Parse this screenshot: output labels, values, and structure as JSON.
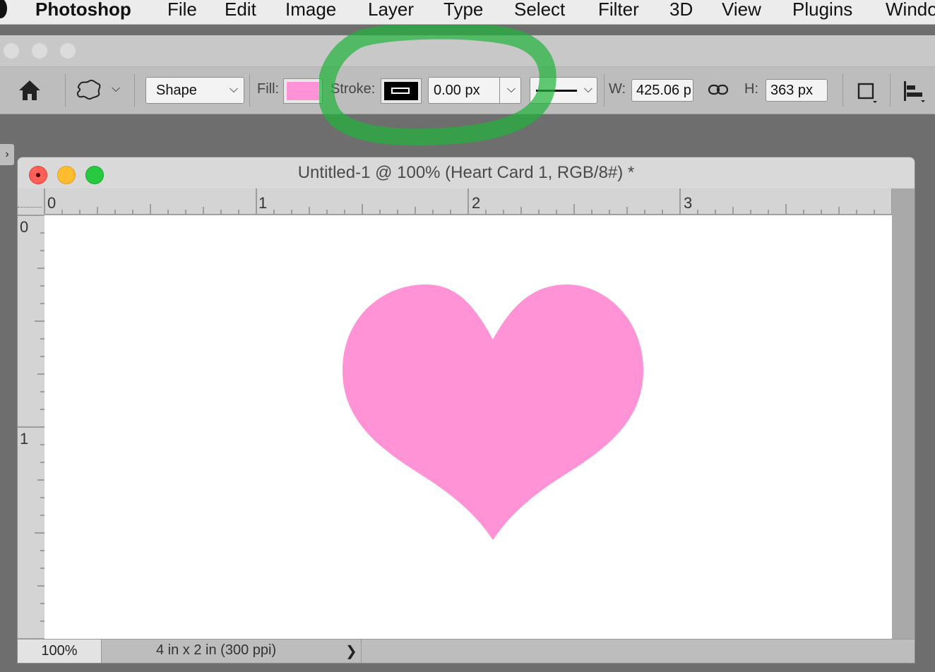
{
  "menubar": {
    "app_name": "Photoshop",
    "items": [
      "File",
      "Edit",
      "Image",
      "Layer",
      "Type",
      "Select",
      "Filter",
      "3D",
      "View",
      "Plugins",
      "Windo"
    ]
  },
  "options_bar": {
    "tool_mode": "Shape",
    "fill_label": "Fill:",
    "fill_color": "#ff93d6",
    "stroke_label": "Stroke:",
    "stroke_color": "#000000",
    "stroke_width": "0.00 px",
    "width_label": "W:",
    "width_value": "425.06 p",
    "height_label": "H:",
    "height_value": "363 px"
  },
  "document": {
    "title": "Untitled-1 @ 100% (Heart Card 1, RGB/8#) *",
    "ruler_h_labels": [
      "0",
      "1",
      "2",
      "3"
    ],
    "ruler_v_labels": [
      "0",
      "1"
    ],
    "shape_color": "#ff93d6"
  },
  "status": {
    "zoom": "100%",
    "doc_size": "4 in x 2 in (300 ppi)",
    "arrow": "❯"
  },
  "annotation_color": "#20b23a"
}
